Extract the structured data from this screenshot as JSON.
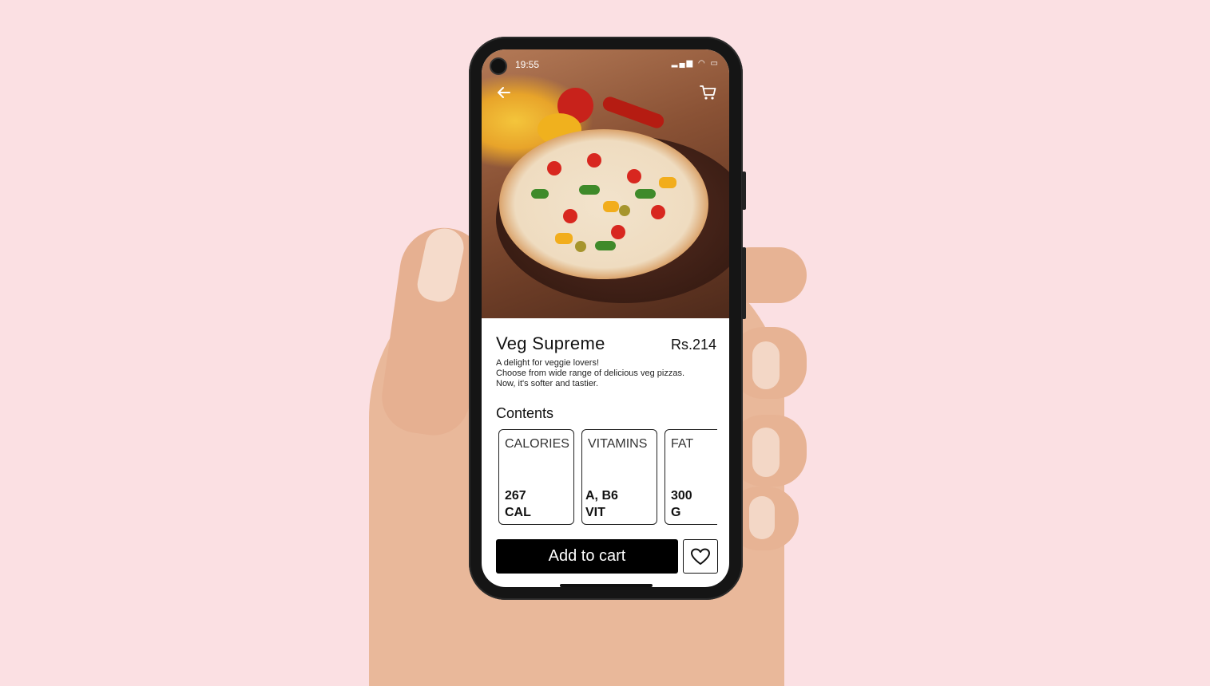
{
  "status_bar": {
    "time": "19:55"
  },
  "product": {
    "name": "Veg Supreme",
    "price": "Rs.214",
    "description_lines": [
      "A delight for veggie lovers!",
      "Choose from wide range of delicious veg pizzas.",
      "Now, it's softer and tastier."
    ]
  },
  "contents": {
    "title": "Contents",
    "cards": [
      {
        "label": "CALORIES",
        "value_line1": "267",
        "value_line2": "CAL"
      },
      {
        "label": "VITAMINS",
        "value_line1": "A, B6",
        "value_line2": "VIT"
      },
      {
        "label": "FAT",
        "value_line1": "300",
        "value_line2": "G"
      }
    ]
  },
  "actions": {
    "add_to_cart": "Add to cart"
  },
  "icons": {
    "back": "arrow-left-icon",
    "cart": "cart-icon",
    "favorite": "heart-icon"
  },
  "colors": {
    "background": "#fbe0e3",
    "button": "#000000"
  }
}
